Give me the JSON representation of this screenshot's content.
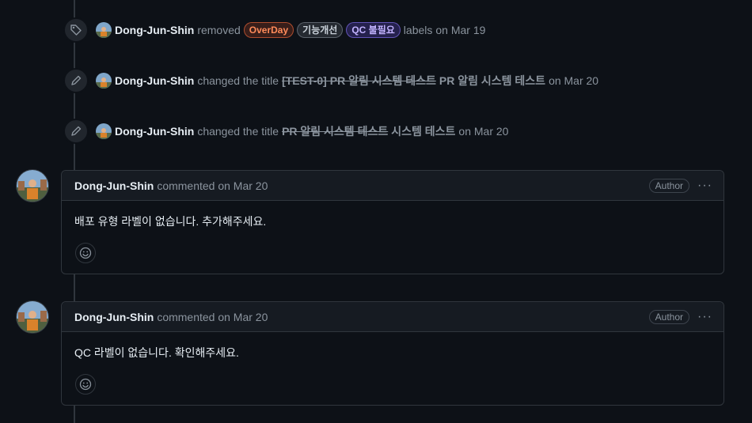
{
  "colors": {
    "background": "#0d1117",
    "header_bg": "#161b22",
    "border": "#30363d",
    "muted": "#8b949e"
  },
  "events": [
    {
      "icon": "tag-icon",
      "actor": "Dong-Jun-Shin",
      "action": "removed",
      "labels": [
        "OverDay",
        "기능개선",
        "QC 불필요"
      ],
      "suffix": "labels",
      "date": "on Mar 19"
    },
    {
      "icon": "pencil-icon",
      "actor": "Dong-Jun-Shin",
      "action": "changed the title",
      "old_title": "[TEST-0] PR 알림 시스템 테스트",
      "new_title": "PR 알림 시스템 테스트",
      "date": "on Mar 20"
    },
    {
      "icon": "pencil-icon",
      "actor": "Dong-Jun-Shin",
      "action": "changed the title",
      "old_title": "PR 알림 시스템 테스트",
      "new_title": "시스템 테스트",
      "date": "on Mar 20"
    }
  ],
  "comments": [
    {
      "author": "Dong-Jun-Shin",
      "meta": "commented on Mar 20",
      "badge": "Author",
      "menu": "···",
      "body": "배포 유형 라벨이 없습니다. 추가해주세요."
    },
    {
      "author": "Dong-Jun-Shin",
      "meta": "commented on Mar 20",
      "badge": "Author",
      "menu": "···",
      "body": "QC 라벨이 없습니다. 확인해주세요."
    }
  ]
}
